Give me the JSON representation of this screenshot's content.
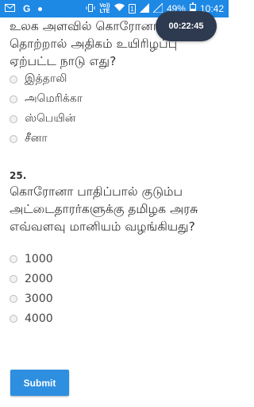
{
  "status_bar": {
    "network_label": "Vo)) LTE",
    "sim_label": "1",
    "battery_percent": "49%",
    "battery_level": 0.49,
    "time": "10:42"
  },
  "timer": "00:22:45",
  "question24": {
    "text": "உலக அளவில் கொரோனா தொற்றால் அதிகம் உயிரிழப்பு ஏற்பட்ட நாடு எது?",
    "options": [
      "இத்தாலி",
      "அமெரிக்கா",
      "ஸ்பெயின்",
      "சீனா"
    ]
  },
  "question25": {
    "number": "25.",
    "text": "கொரோனா பாதிப்பால் குடும்ப அட்டைதாரர்களுக்கு தமிழக அரசு எவ்வளவு மானியம் வழங்கியது?",
    "options": [
      "1000",
      "2000",
      "3000",
      "4000"
    ]
  },
  "submit_label": "Submit"
}
